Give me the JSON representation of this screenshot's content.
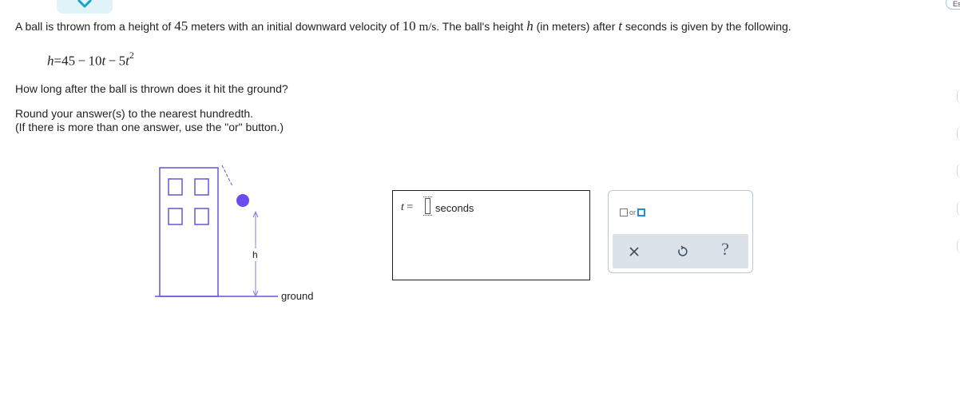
{
  "header": {
    "lang_pill_label": "Es"
  },
  "problem": {
    "part1": "A ball is thrown from a height of ",
    "height_value": "45",
    "part2": " meters with an initial downward velocity of ",
    "velocity_value": "10",
    "velocity_unit": "m/s",
    "part3": ". The ball's height ",
    "h_var": "h",
    "part4": " (in meters) after ",
    "t_var": "t",
    "part5": " seconds is given by the following."
  },
  "equation": {
    "lhs": "h",
    "eq": "=",
    "c0": "45",
    "minus1": "−",
    "c1": "10",
    "t1": "t",
    "minus2": "−",
    "c2": "5",
    "t2": "t",
    "exp": "2"
  },
  "question": "How long after the ball is thrown does it hit the ground?",
  "instructions": {
    "line1": "Round your answer(s) to the nearest hundredth.",
    "line2": "(If there is more than one answer, use the \"or\" button.)"
  },
  "figure": {
    "h_label": "h",
    "ground_label": "ground",
    "colors": {
      "building": "#6b52d6",
      "ball": "#6a4cf0"
    }
  },
  "answer": {
    "variable": "t",
    "equals": "=",
    "value": "",
    "units": "seconds"
  },
  "keypad": {
    "or_label": "or",
    "help_label": "?",
    "icons": [
      "clear-x-icon",
      "undo-icon",
      "help-icon"
    ]
  }
}
